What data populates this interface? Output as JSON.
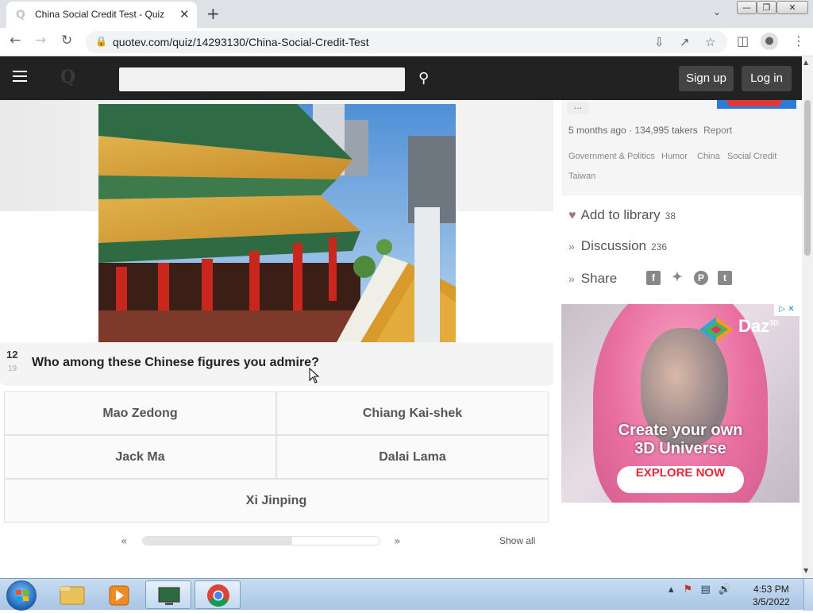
{
  "browser": {
    "tab_title": "China Social Credit Test - Quiz",
    "tab_close": "✕",
    "new_tab": "+",
    "url": "quotev.com/quiz/14293130/China-Social-Credit-Test"
  },
  "site": {
    "logo": "Q",
    "search_placeholder": "",
    "signup_label": "Sign up",
    "login_label": "Log in"
  },
  "question": {
    "number": "12",
    "total": "19",
    "text": "Who among these Chinese figures you admire?"
  },
  "answers": [
    {
      "label": "Mao Zedong"
    },
    {
      "label": "Chiang Kai-shek"
    },
    {
      "label": "Jack Ma"
    },
    {
      "label": "Dalai Lama"
    },
    {
      "label": "Xi Jinping"
    }
  ],
  "pager": {
    "prev": "«",
    "next": "»",
    "progress": 0.63,
    "show_all": "Show all"
  },
  "sidebar": {
    "more": "...",
    "meta": "5 months ago · 134,995 takers",
    "report": "Report",
    "tags": [
      "Government & Politics",
      "Humor",
      "China",
      "Social Credit",
      "Taiwan"
    ],
    "add_library": "Add to library",
    "add_library_count": "38",
    "discussion": "Discussion",
    "discussion_count": "236",
    "share": "Share",
    "share_icons": [
      "facebook-icon",
      "twitter-icon",
      "pinterest-icon",
      "tumblr-icon"
    ]
  },
  "ad": {
    "brand": "Daz",
    "brand_sup": "3D",
    "headline_1": "Create your own",
    "headline_2": "3D Universe",
    "cta": "EXPLORE NOW"
  },
  "taskbar": {
    "time": "4:53 PM",
    "date": "3/5/2022"
  },
  "colors": {
    "site_header": "#222222",
    "ad_cta_text": "#e4293b",
    "chrome_frame": "#dee1e6"
  }
}
